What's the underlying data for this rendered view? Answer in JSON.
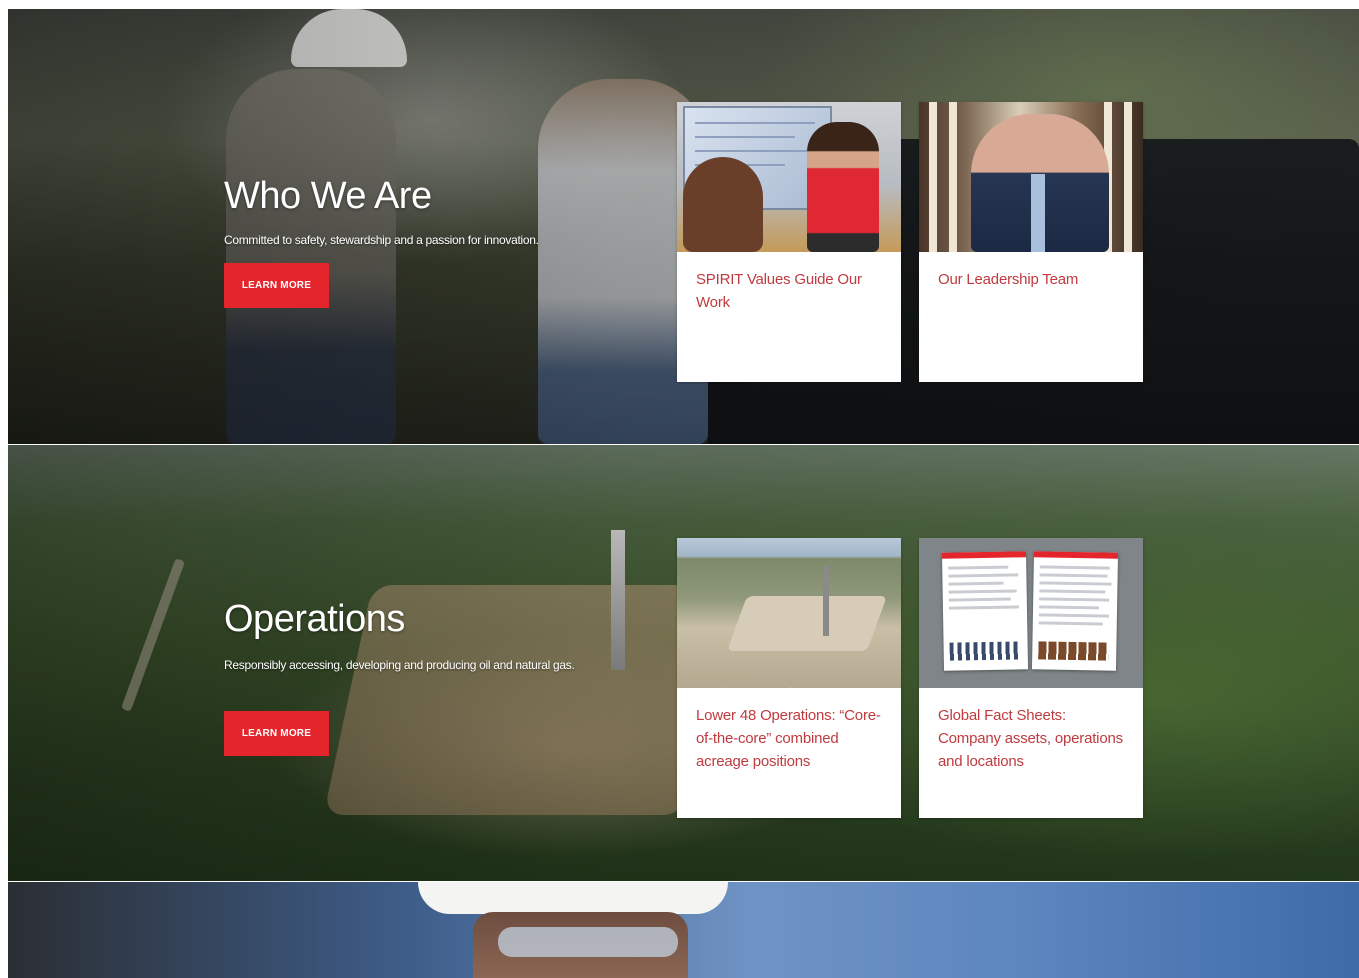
{
  "sections": [
    {
      "title": "Who We Are",
      "description": "Committed to safety, stewardship and a passion for innovation.",
      "button_label": "LEARN MORE",
      "cards": [
        {
          "text": "SPIRIT Values Guide Our Work"
        },
        {
          "text": "Our Leadership Team"
        }
      ]
    },
    {
      "title": "Operations",
      "description": "Responsibly accessing, developing and producing oil and natural gas.",
      "button_label": "LEARN MORE",
      "cards": [
        {
          "text": "Lower 48 Operations: “Core-of-the-core” combined acreage positions"
        },
        {
          "text": "Global Fact Sheets: Company assets, operations and locations"
        }
      ]
    }
  ],
  "colors": {
    "accent_red": "#e4252b",
    "card_link_text": "#c03a3f"
  }
}
